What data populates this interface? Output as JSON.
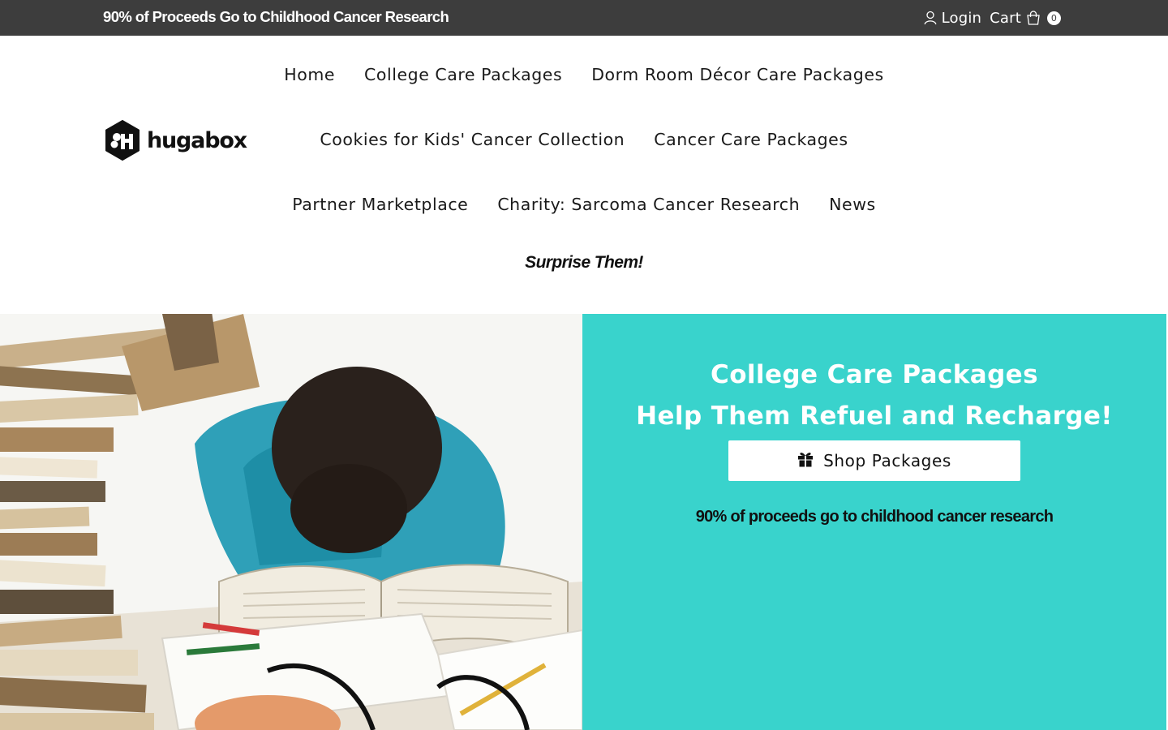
{
  "announcement": "90% of Proceeds Go to Childhood Cancer Research",
  "account": {
    "login_label": "Login",
    "cart_label": "Cart",
    "cart_count": "0"
  },
  "brand": {
    "name": "hugabox"
  },
  "nav": {
    "row1": [
      "Home",
      "College Care Packages",
      "Dorm Room Décor Care Packages"
    ],
    "row2": [
      "Cookies for Kids' Cancer Collection",
      "Cancer Care Packages"
    ],
    "row3": [
      "Partner Marketplace",
      "Charity: Sarcoma Cancer Research",
      "News"
    ],
    "highlight": "Surprise Them!"
  },
  "hero": {
    "title_line1": "College Care Packages",
    "title_line2": "Help Them Refuel and Recharge!",
    "button_label": "Shop Packages",
    "note": "90% of proceeds go to childhood cancer research",
    "panel_color": "#39d3cc",
    "image_description_icon": "student-asleep-on-books-photo"
  },
  "colors": {
    "topbar": "#3d3d3d",
    "accent": "#39d3cc"
  },
  "icons": {
    "login": "user-icon",
    "cart": "shopping-bag-icon",
    "button": "gift-icon"
  }
}
